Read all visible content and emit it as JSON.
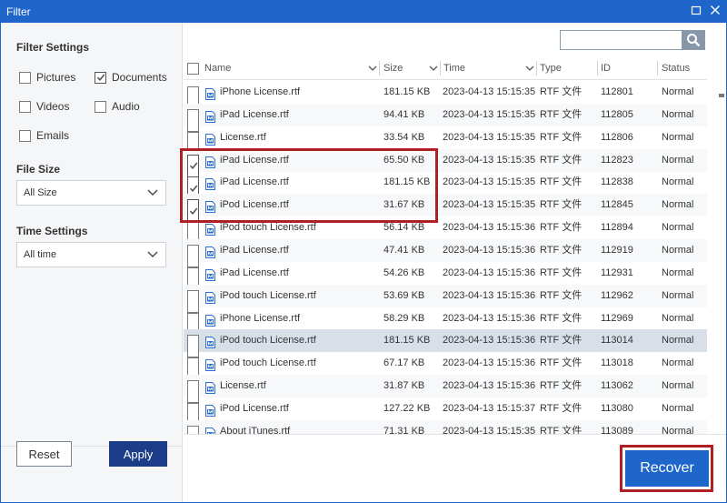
{
  "window": {
    "title": "Filter",
    "minimize_icon": "minimize-icon",
    "close_icon": "close-icon"
  },
  "sidebar": {
    "filter_settings": "Filter Settings",
    "types": [
      {
        "label": "Pictures",
        "checked": false
      },
      {
        "label": "Documents",
        "checked": true
      },
      {
        "label": "Videos",
        "checked": false
      },
      {
        "label": "Audio",
        "checked": false
      },
      {
        "label": "Emails",
        "checked": false
      }
    ],
    "file_size_heading": "File Size",
    "file_size_value": "All Size",
    "time_heading": "Time Settings",
    "time_value": "All time",
    "reset": "Reset",
    "apply": "Apply"
  },
  "search": {
    "value": "",
    "icon": "magnifier-icon"
  },
  "table": {
    "columns": [
      "Name",
      "Size",
      "Time",
      "Type",
      "ID",
      "Status"
    ],
    "rows": [
      {
        "checked": false,
        "name": "iPhone License.rtf",
        "size": "181.15 KB",
        "time": "2023-04-13 15:15:35",
        "type": "RTF 文件",
        "id": "112801",
        "status": "Normal"
      },
      {
        "checked": false,
        "name": "iPad License.rtf",
        "size": "94.41 KB",
        "time": "2023-04-13 15:15:35",
        "type": "RTF 文件",
        "id": "112805",
        "status": "Normal"
      },
      {
        "checked": false,
        "name": "License.rtf",
        "size": "33.54 KB",
        "time": "2023-04-13 15:15:35",
        "type": "RTF 文件",
        "id": "112806",
        "status": "Normal"
      },
      {
        "checked": true,
        "name": "iPad License.rtf",
        "size": "65.50 KB",
        "time": "2023-04-13 15:15:35",
        "type": "RTF 文件",
        "id": "112823",
        "status": "Normal"
      },
      {
        "checked": true,
        "name": "iPad License.rtf",
        "size": "181.15 KB",
        "time": "2023-04-13 15:15:35",
        "type": "RTF 文件",
        "id": "112838",
        "status": "Normal"
      },
      {
        "checked": true,
        "name": "iPod License.rtf",
        "size": "31.67 KB",
        "time": "2023-04-13 15:15:35",
        "type": "RTF 文件",
        "id": "112845",
        "status": "Normal"
      },
      {
        "checked": false,
        "name": "iPod touch License.rtf",
        "size": "56.14 KB",
        "time": "2023-04-13 15:15:36",
        "type": "RTF 文件",
        "id": "112894",
        "status": "Normal"
      },
      {
        "checked": false,
        "name": "iPad License.rtf",
        "size": "47.41 KB",
        "time": "2023-04-13 15:15:36",
        "type": "RTF 文件",
        "id": "112919",
        "status": "Normal"
      },
      {
        "checked": false,
        "name": "iPad License.rtf",
        "size": "54.26 KB",
        "time": "2023-04-13 15:15:36",
        "type": "RTF 文件",
        "id": "112931",
        "status": "Normal"
      },
      {
        "checked": false,
        "name": "iPod touch License.rtf",
        "size": "53.69 KB",
        "time": "2023-04-13 15:15:36",
        "type": "RTF 文件",
        "id": "112962",
        "status": "Normal"
      },
      {
        "checked": false,
        "name": "iPhone License.rtf",
        "size": "58.29 KB",
        "time": "2023-04-13 15:15:36",
        "type": "RTF 文件",
        "id": "112969",
        "status": "Normal"
      },
      {
        "checked": false,
        "name": "iPod touch License.rtf",
        "size": "181.15 KB",
        "time": "2023-04-13 15:15:36",
        "type": "RTF 文件",
        "id": "113014",
        "status": "Normal",
        "selected": true
      },
      {
        "checked": false,
        "name": "iPod touch License.rtf",
        "size": "67.17 KB",
        "time": "2023-04-13 15:15:36",
        "type": "RTF 文件",
        "id": "113018",
        "status": "Normal"
      },
      {
        "checked": false,
        "name": "License.rtf",
        "size": "31.87 KB",
        "time": "2023-04-13 15:15:36",
        "type": "RTF 文件",
        "id": "113062",
        "status": "Normal"
      },
      {
        "checked": false,
        "name": "iPod License.rtf",
        "size": "127.22 KB",
        "time": "2023-04-13 15:15:37",
        "type": "RTF 文件",
        "id": "113080",
        "status": "Normal"
      },
      {
        "checked": false,
        "name": "About iTunes.rtf",
        "size": "71.31 KB",
        "time": "2023-04-13 15:15:35",
        "type": "RTF 文件",
        "id": "113089",
        "status": "Normal"
      }
    ]
  },
  "recover": "Recover",
  "colors": {
    "accent": "#1e66c9",
    "apply": "#1c3e8a",
    "highlight": "#b01f23",
    "selected_row": "#d9dfe9"
  }
}
